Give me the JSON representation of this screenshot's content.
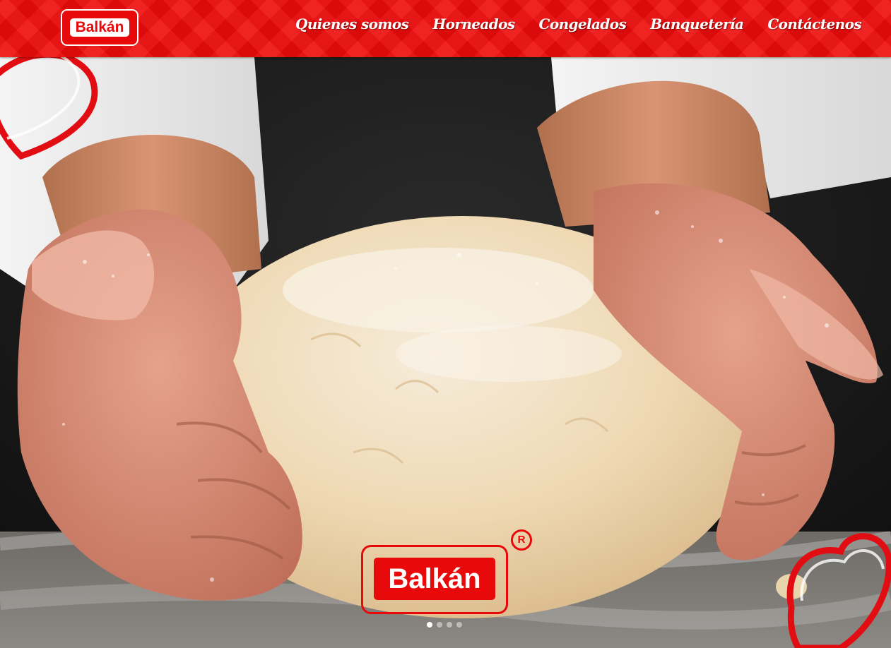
{
  "header": {
    "logo_text": "Balkán",
    "nav": [
      {
        "label": "Quienes somos"
      },
      {
        "label": "Horneados"
      },
      {
        "label": "Congelados"
      },
      {
        "label": "Banquetería"
      },
      {
        "label": "Contáctenos"
      }
    ]
  },
  "hero": {
    "brand_text": "Balkán",
    "registered_mark": "R",
    "slider": {
      "count": 4,
      "active_index": 0
    }
  },
  "colors": {
    "brand_red": "#ee0b0b",
    "text_white": "#ffffff"
  },
  "icons": [
    "heart-outline-icon",
    "registered-mark-icon"
  ]
}
